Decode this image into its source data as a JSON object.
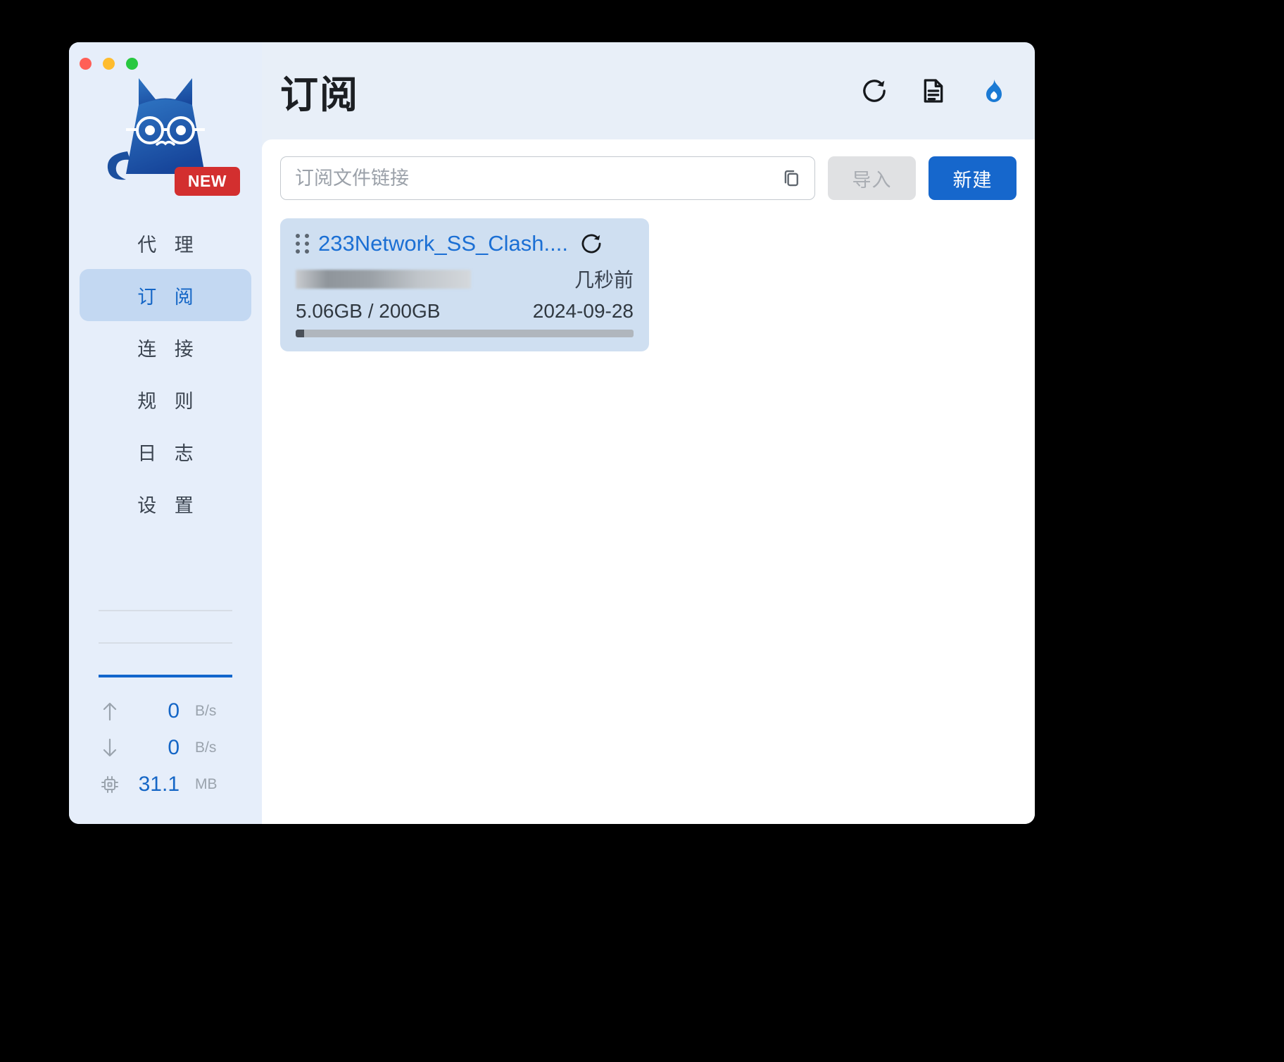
{
  "window": {
    "traffic_lights": [
      "close",
      "minimize",
      "maximize"
    ],
    "badge_label": "NEW"
  },
  "sidebar": {
    "items": [
      {
        "label": "代 理",
        "name": "proxy",
        "active": false
      },
      {
        "label": "订 阅",
        "name": "subscription",
        "active": true
      },
      {
        "label": "连 接",
        "name": "connections",
        "active": false
      },
      {
        "label": "规 则",
        "name": "rules",
        "active": false
      },
      {
        "label": "日 志",
        "name": "logs",
        "active": false
      },
      {
        "label": "设 置",
        "name": "settings",
        "active": false
      }
    ],
    "stats": [
      {
        "icon": "arrow-up-icon",
        "value": "0",
        "unit": "B/s"
      },
      {
        "icon": "arrow-down-icon",
        "value": "0",
        "unit": "B/s"
      },
      {
        "icon": "memory-chip-icon",
        "value": "31.1",
        "unit": "MB"
      }
    ]
  },
  "header": {
    "title": "订阅",
    "actions": [
      {
        "name": "refresh-icon",
        "label": "刷新"
      },
      {
        "name": "file-document-icon",
        "label": "文件"
      },
      {
        "name": "flame-icon",
        "label": "加速"
      }
    ]
  },
  "toolbar": {
    "url_placeholder": "订阅文件链接",
    "url_value": "",
    "paste_icon": "copy-icon",
    "import_label": "导入",
    "import_disabled": true,
    "new_label": "新建"
  },
  "subscriptions": [
    {
      "title": "233Network_SS_Clash....",
      "url_redacted": true,
      "updated": "几秒前",
      "usage": "5.06GB / 200GB",
      "expire": "2024-09-28",
      "progress_percent": 2.5,
      "refresh_icon": "refresh-icon",
      "drag_icon": "drag-handle-icon"
    }
  ],
  "colors": {
    "accent": "#1667cc",
    "card_bg": "#cfdff1",
    "sidebar_bg": "#e6eefa",
    "active_nav_bg": "#c3d8f2",
    "badge_red": "#d32f2f"
  }
}
